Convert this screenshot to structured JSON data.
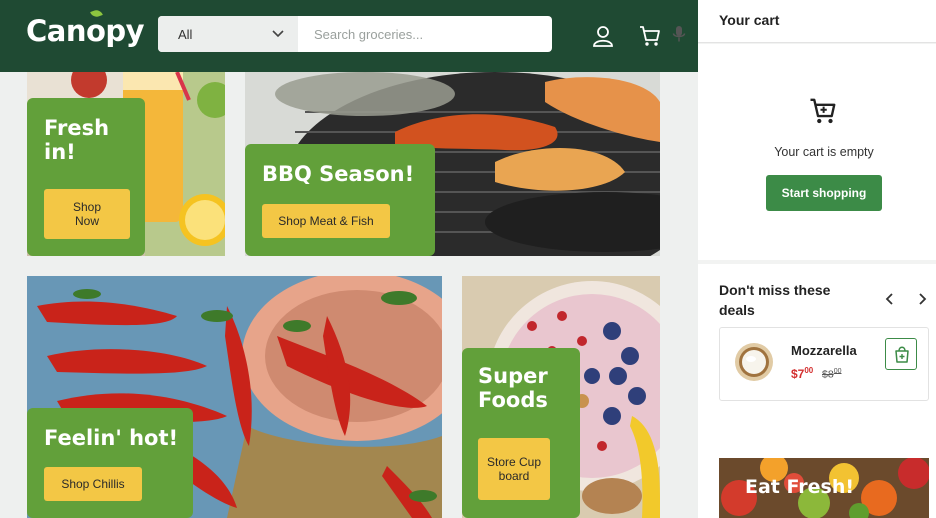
{
  "header": {
    "logo": "Canopy",
    "search": {
      "category": "All",
      "placeholder": "Search groceries..."
    }
  },
  "promos": [
    {
      "title": "Fresh in!",
      "button": "Shop Now"
    },
    {
      "title": "BBQ Season!",
      "button": "Shop Meat & Fish"
    },
    {
      "title": "Feelin' hot!",
      "button": "Shop Chillis"
    },
    {
      "title": "Super Foods",
      "button": "Store Cupboard"
    }
  ],
  "cart": {
    "title": "Your cart",
    "empty_text": "Your cart is empty",
    "start_button": "Start shopping"
  },
  "deals": {
    "title": "Don't miss these deals",
    "items": [
      {
        "name": "Mozzarella",
        "price": "$7",
        "price_cents": "00",
        "old_price": "$8",
        "old_price_cents": "00"
      }
    ]
  },
  "banner": {
    "title": "Eat Fresh!"
  },
  "colors": {
    "brand_green": "#1f4a33",
    "panel_green": "#62a03a",
    "button_yellow": "#f3c745",
    "cta_green": "#3c8b47",
    "price_red": "#d32f2f"
  }
}
